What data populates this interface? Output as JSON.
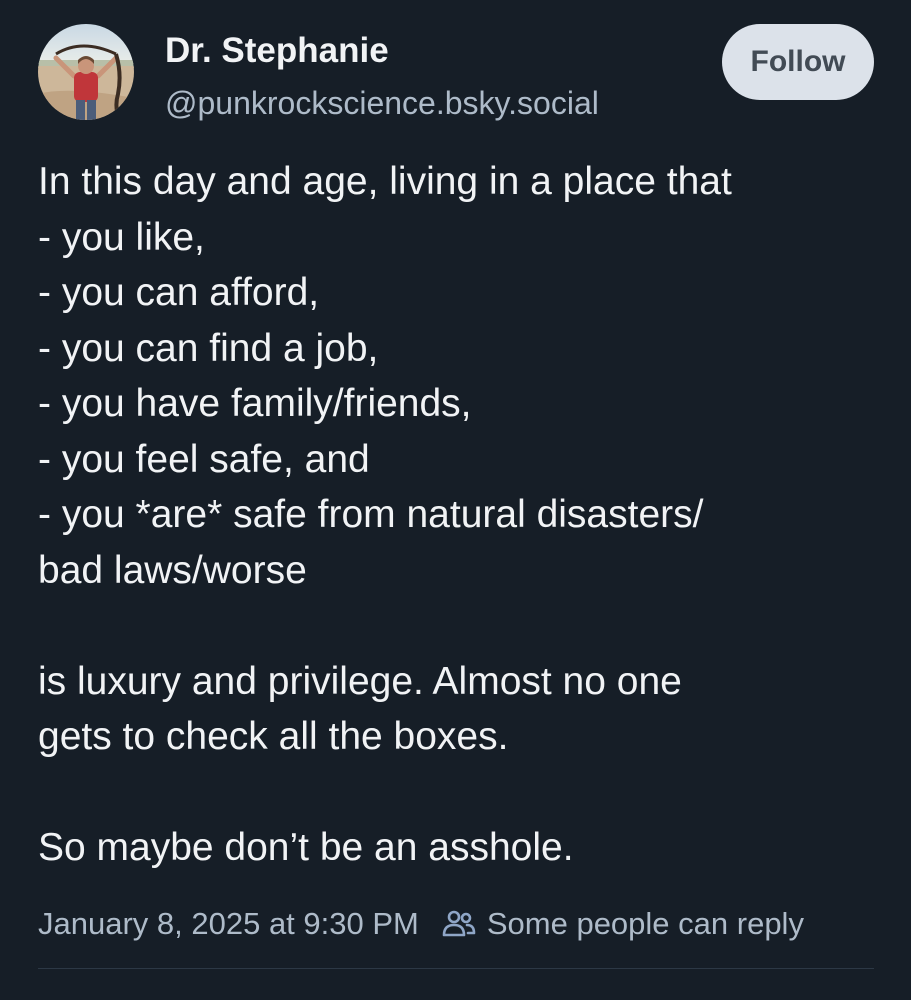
{
  "author": {
    "display_name": "Dr. Stephanie",
    "handle": "@punkrockscience.bsky.social",
    "avatar_icon": "avatar-photo"
  },
  "follow_button": {
    "label": "Follow"
  },
  "post": {
    "lines": [
      "In this day and age, living in a place that",
      "- you like,",
      "- you can afford,",
      "- you can find a job,",
      "- you have family/friends,",
      "- you feel safe, and",
      "- you *are* safe from natural disasters/",
      "bad laws/worse",
      "",
      "is luxury and privilege. Almost no one",
      "gets to check all the boxes.",
      "",
      "So maybe don’t be an asshole."
    ]
  },
  "meta": {
    "timestamp": "January 8, 2025 at 9:30 PM",
    "reply_icon": "people-icon",
    "reply_setting": "Some people can reply"
  },
  "colors": {
    "background": "#161e27",
    "text_primary": "#f1f3f5",
    "text_secondary": "#aebbc9",
    "follow_button_bg": "#dce2ea",
    "follow_button_text": "#424b55",
    "divider": "#2c3845"
  }
}
